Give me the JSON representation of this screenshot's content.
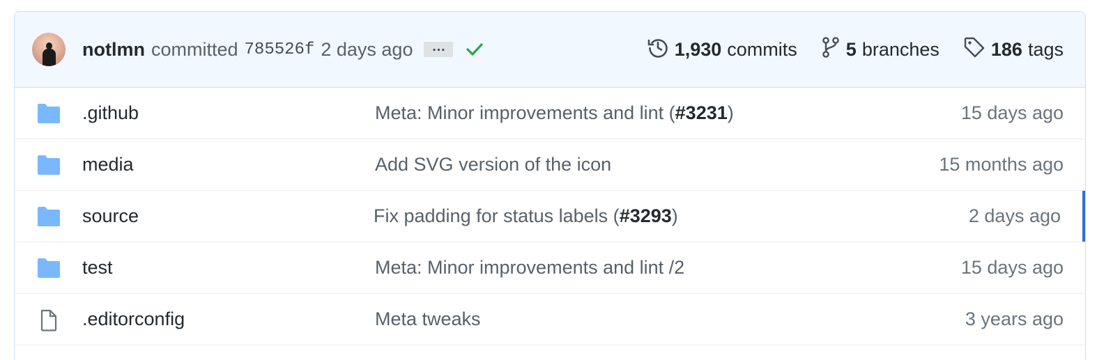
{
  "latest_commit": {
    "author": "notlmn",
    "action": "committed",
    "sha": "785526f",
    "time": "2 days ago",
    "ellipsis": "…",
    "status": "success"
  },
  "stats": {
    "commits_count": "1,930",
    "commits_label": "commits",
    "branches_count": "5",
    "branches_label": "branches",
    "tags_count": "186",
    "tags_label": "tags"
  },
  "files": [
    {
      "type": "folder",
      "name": ".github",
      "message": "Meta: Minor improvements and lint (",
      "issue": "#3231",
      "message_end": ")",
      "age": "15 days ago"
    },
    {
      "type": "folder",
      "name": "media",
      "message": "Add SVG version of the icon",
      "issue": "",
      "message_end": "",
      "age": "15 months ago"
    },
    {
      "type": "folder",
      "name": "source",
      "message": "Fix padding for status labels (",
      "issue": "#3293",
      "message_end": ")",
      "age": "2 days ago"
    },
    {
      "type": "folder",
      "name": "test",
      "message": "Meta: Minor improvements and lint /2",
      "issue": "",
      "message_end": "",
      "age": "15 days ago"
    },
    {
      "type": "file",
      "name": ".editorconfig",
      "message": "Meta tweaks",
      "issue": "",
      "message_end": "",
      "age": "3 years ago"
    }
  ],
  "colors": {
    "header_bg": "#f1f8ff",
    "border": "#c8e1ff",
    "folder": "#79b8ff",
    "success": "#28a745",
    "active_indicator": "#2f6fde"
  }
}
